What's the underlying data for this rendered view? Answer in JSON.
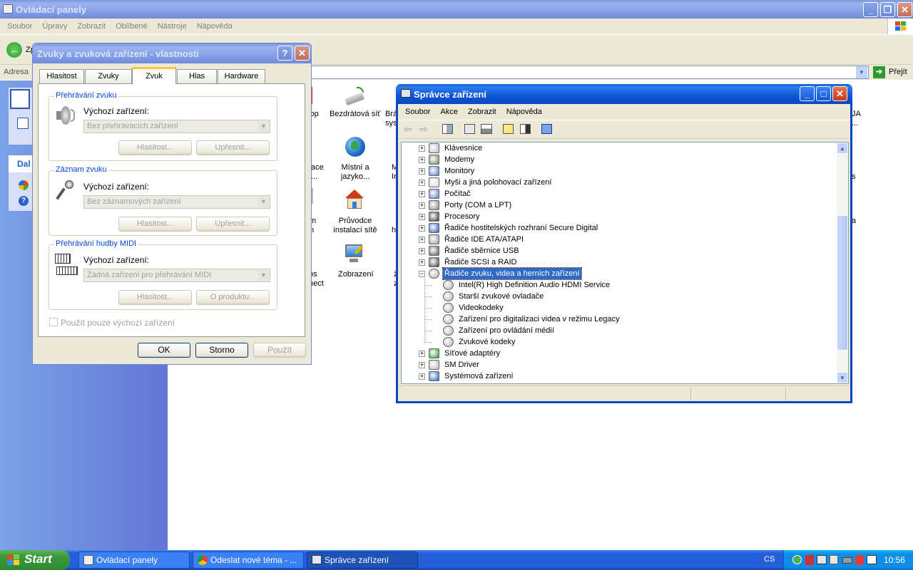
{
  "control_panel": {
    "title": "Ovládací panely",
    "menu": [
      "Soubor",
      "Úpravy",
      "Zobrazit",
      "Oblíbené",
      "Nástroje",
      "Nápověda"
    ],
    "address_label": "Adresa",
    "go_label": "Přejít",
    "back_partial": "Zp",
    "sidebar_partial": "Dal",
    "icons": [
      {
        "label": "ktop",
        "name": "desktop-partial"
      },
      {
        "label": "Bezdrátová síť",
        "name": "wireless-network-icon"
      },
      {
        "label": "Brá sys",
        "name": "partial"
      },
      {
        "label": "ace ...",
        "name": "partial"
      },
      {
        "label": "Místní a jazyko...",
        "name": "regional-language-icon"
      },
      {
        "label": "M In",
        "name": "partial"
      },
      {
        "label": "m n",
        "name": "partial"
      },
      {
        "label": "Průvodce instalací sítě",
        "name": "network-setup-wizard-icon"
      },
      {
        "label": "h",
        "name": "partial"
      },
      {
        "label": "ps nect",
        "name": "partial"
      },
      {
        "label": "Zobrazení",
        "name": "display-icon"
      },
      {
        "label": "z",
        "name": "partial"
      }
    ],
    "right_partials": [
      "JA ...",
      "s",
      "a"
    ]
  },
  "sound_dialog": {
    "title": "Zvuky a zvuková zařízení - vlastnosti",
    "tabs": [
      "Hlasitost",
      "Zvuky",
      "Zvuk",
      "Hlas",
      "Hardware"
    ],
    "active_tab": "Zvuk",
    "playback": {
      "group_title": "Přehrávání zvuku",
      "device_label": "Výchozí zařízení:",
      "device_value": "Bez přehrávacích zařízení",
      "volume_button": "Hlasitost...",
      "advanced_button": "Upřesnit..."
    },
    "recording": {
      "group_title": "Záznam zvuku",
      "device_label": "Výchozí zařízení:",
      "device_value": "Bez záznamových zařízení",
      "volume_button": "Hlasitost...",
      "advanced_button": "Upřesnit..."
    },
    "midi": {
      "group_title": "Přehrávání hudby MIDI",
      "device_label": "Výchozí zařízení:",
      "device_value": "Žádná zařízení pro přehrávání MIDI",
      "volume_button": "Hlasitost...",
      "about_button": "O produktu..."
    },
    "default_only_checkbox": "Použít pouze výchozí zařízení",
    "ok_button": "OK",
    "cancel_button": "Storno",
    "apply_button": "Použít"
  },
  "device_manager": {
    "title": "Správce zařízení",
    "menu": [
      "Soubor",
      "Akce",
      "Zobrazit",
      "Nápověda"
    ],
    "tree": [
      {
        "label": "Klávesnice",
        "expander": "+",
        "level": 0,
        "icon": "keyboard-icon"
      },
      {
        "label": "Modemy",
        "expander": "+",
        "level": 0,
        "icon": "modem-icon"
      },
      {
        "label": "Monitory",
        "expander": "+",
        "level": 0,
        "icon": "monitor-icon"
      },
      {
        "label": "Myši a jiná polohovací zařízení",
        "expander": "+",
        "level": 0,
        "icon": "mouse-icon"
      },
      {
        "label": "Počítač",
        "expander": "+",
        "level": 0,
        "icon": "computer-icon"
      },
      {
        "label": "Porty (COM a LPT)",
        "expander": "+",
        "level": 0,
        "icon": "port-icon"
      },
      {
        "label": "Procesory",
        "expander": "+",
        "level": 0,
        "icon": "processor-icon"
      },
      {
        "label": "Řadiče hostitelských rozhraní Secure Digital",
        "expander": "+",
        "level": 0,
        "icon": "sd-host-icon"
      },
      {
        "label": "Řadiče IDE ATA/ATAPI",
        "expander": "+",
        "level": 0,
        "icon": "ide-icon"
      },
      {
        "label": "Řadiče sběrnice USB",
        "expander": "+",
        "level": 0,
        "icon": "usb-icon"
      },
      {
        "label": "Řadiče SCSI a RAID",
        "expander": "+",
        "level": 0,
        "icon": "scsi-icon"
      },
      {
        "label": "Řadiče zvuku, videa a herních zařízení",
        "expander": "−",
        "level": 0,
        "icon": "sound-video-icon",
        "selected": true
      },
      {
        "label": "Intel(R) High Definition Audio HDMI Service",
        "level": 1,
        "icon": "sound-device-icon"
      },
      {
        "label": "Starší zvukové ovladače",
        "level": 1,
        "icon": "sound-device-icon"
      },
      {
        "label": "Videokodeky",
        "level": 1,
        "icon": "sound-device-icon"
      },
      {
        "label": "Zařízení pro digitalizaci videa v režimu Legacy",
        "level": 1,
        "icon": "sound-device-icon"
      },
      {
        "label": "Zařízení pro ovládání médií",
        "level": 1,
        "icon": "sound-device-icon"
      },
      {
        "label": "Zvukové kodeky",
        "level": 1,
        "icon": "sound-device-icon"
      },
      {
        "label": "Síťové adaptéry",
        "expander": "+",
        "level": 0,
        "icon": "network-adapter-icon"
      },
      {
        "label": "SM Driver",
        "expander": "+",
        "level": 0,
        "icon": "sm-driver-icon"
      },
      {
        "label": "Systémová zařízení",
        "expander": "+",
        "level": 0,
        "icon": "system-devices-icon"
      }
    ]
  },
  "taskbar": {
    "start_label": "Start",
    "tasks": [
      {
        "label": "Ovládací panely",
        "icon": "control-panel-icon",
        "active": false
      },
      {
        "label": "Odeslat nové téma - ...",
        "icon": "chrome-icon",
        "active": false
      },
      {
        "label": "Správce zařízení",
        "icon": "device-manager-icon",
        "active": true
      }
    ],
    "language": "CS",
    "clock": "10:56"
  },
  "colors": {
    "xp_blue": "#0a5fd8",
    "taskbar_blue": "#245edb",
    "start_green": "#3c9a3c",
    "tray_blue": "#0f8ee7",
    "selection": "#316ac5"
  }
}
